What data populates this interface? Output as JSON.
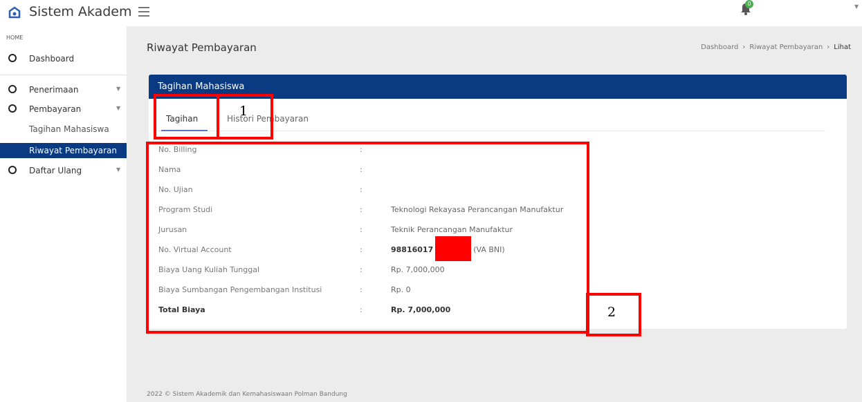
{
  "app": {
    "title": "Sistem Akademik"
  },
  "topbar": {
    "notification_count": "0"
  },
  "sidebar": {
    "section": "HOME",
    "dashboard": "Dashboard",
    "items": [
      {
        "label": "Penerimaan"
      },
      {
        "label": "Pembayaran"
      }
    ],
    "sub_items": [
      {
        "label": "Tagihan Mahasiswa"
      },
      {
        "label": "Riwayat Pembayaran"
      }
    ],
    "daftar_ulang": "Daftar Ulang"
  },
  "page": {
    "title": "Riwayat Pembayaran"
  },
  "breadcrumb": {
    "home": "Dashboard",
    "parent": "Riwayat Pembayaran",
    "current": "Lihat"
  },
  "card": {
    "title": "Tagihan Mahasiswa",
    "tabs": [
      "Tagihan",
      "Histori Pembayaran"
    ]
  },
  "info": [
    {
      "key": "No. Billing",
      "value": ""
    },
    {
      "key": "Nama",
      "value": ""
    },
    {
      "key": "No. Ujian",
      "value": ""
    },
    {
      "key": "Program Studi",
      "value": "Teknologi Rekayasa Perancangan Manufaktur"
    },
    {
      "key": "Jurusan",
      "value": "Teknik Perancangan Manufaktur"
    },
    {
      "key": "No. Virtual Account",
      "value": "98816017",
      "suffix": "(VA BNI)"
    },
    {
      "key": "Biaya Uang Kuliah Tunggal",
      "value": "Rp. 7,000,000"
    },
    {
      "key": "Biaya Sumbangan Pengembangan Institusi",
      "value": "Rp. 0"
    },
    {
      "key": "Total Biaya",
      "value": "Rp. 7,000,000"
    }
  ],
  "colon": ":",
  "annotations": {
    "first": "1",
    "second": "2"
  },
  "footer": "2022 © Sistem Akademik dan Kemahasiswaan Polman Bandung",
  "colors": {
    "primary": "#0a3a82",
    "annotation": "#ff0000"
  }
}
